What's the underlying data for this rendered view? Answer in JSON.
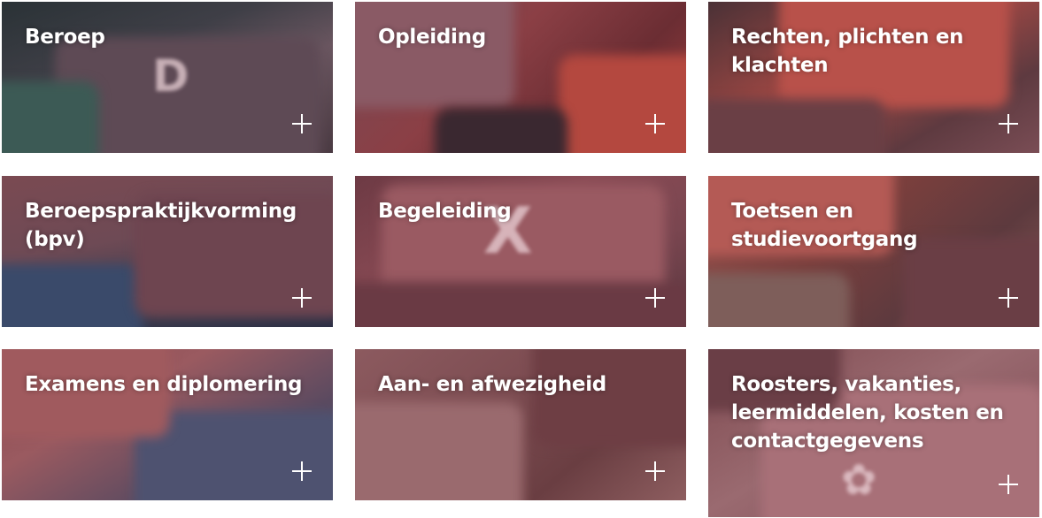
{
  "tiles": [
    {
      "title": "Beroep"
    },
    {
      "title": "Opleiding"
    },
    {
      "title": "Rechten, plichten en klachten"
    },
    {
      "title": "Beroepspraktijkvorming (bpv)"
    },
    {
      "title": "Begeleiding"
    },
    {
      "title": "Toetsen en studievoortgang"
    },
    {
      "title": "Examens en diplomering"
    },
    {
      "title": "Aan- en afwezigheid"
    },
    {
      "title": "Roosters, vakanties, leermiddelen, kosten en contactgegevens"
    }
  ],
  "icons": {
    "expand": "plus-icon"
  },
  "colors": {
    "text": "#ffffff",
    "background": "#ffffff"
  }
}
